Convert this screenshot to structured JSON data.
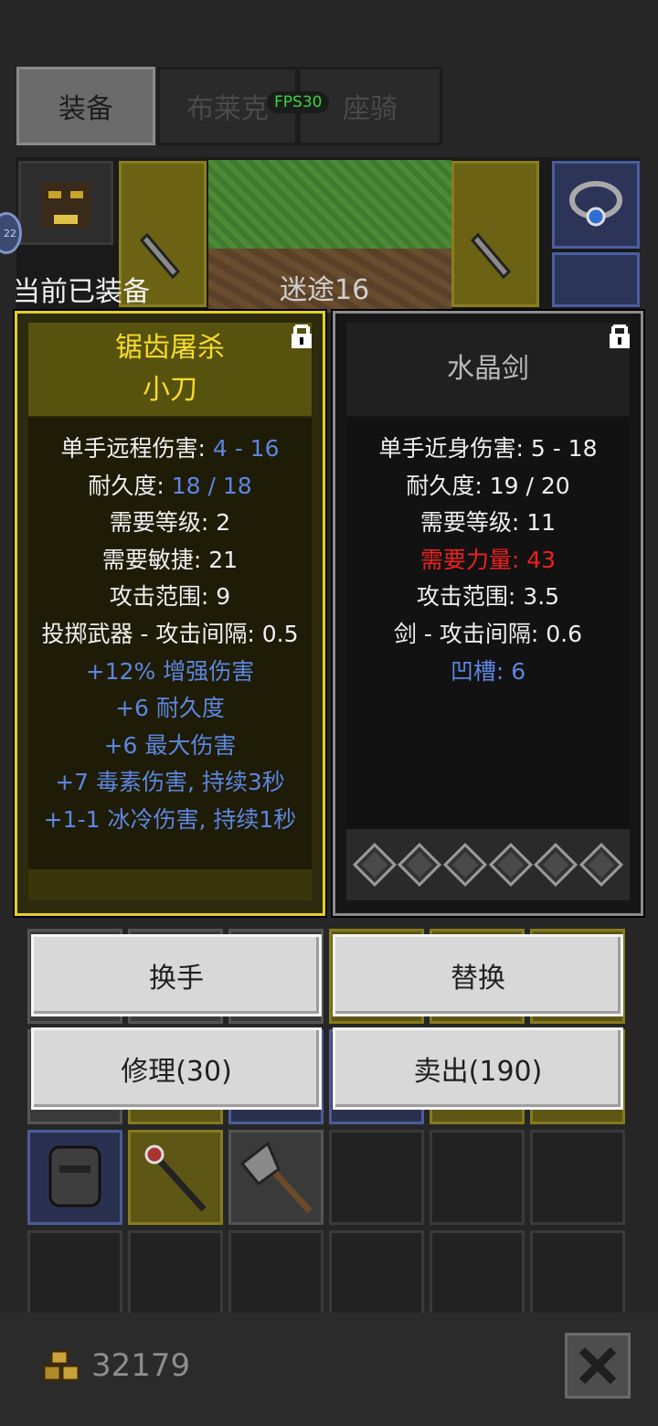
{
  "tabs": {
    "equip": "装备",
    "blake": "布莱克",
    "mount": "座骑"
  },
  "fps": "FPS30",
  "scene": {
    "map_label": "迷途16",
    "badge": "22"
  },
  "current_equipped_label": "当前已装备",
  "left_item": {
    "name_line1": "锯齿屠杀",
    "name_line2": "小刀",
    "stats": [
      {
        "label": "单手远程伤害: ",
        "value": "4 - 16"
      },
      {
        "label": "耐久度: ",
        "value": "18 / 18"
      },
      {
        "label": "需要等级: ",
        "value": "2"
      },
      {
        "label": "需要敏捷: ",
        "value": "21"
      },
      {
        "label": "攻击范围: ",
        "value": "9"
      },
      {
        "label": "投掷武器 - 攻击间隔: ",
        "value": "0.5"
      }
    ],
    "affixes": [
      "+12% 增强伤害",
      "+6 耐久度",
      "+6 最大伤害",
      "+7 毒素伤害, 持续3秒",
      "+1-1 冰冷伤害, 持续1秒"
    ]
  },
  "right_item": {
    "name": "水晶剑",
    "stats": [
      {
        "label": "单手近身伤害: ",
        "value": "5 - 18"
      },
      {
        "label": "耐久度: ",
        "value": "19 / 20"
      },
      {
        "label": "需要等级: ",
        "value": "11"
      },
      {
        "label": "需要力量: ",
        "value": "43"
      },
      {
        "label": "攻击范围: ",
        "value": "3.5"
      },
      {
        "label": "剑 - 攻击间隔: ",
        "value": "0.6"
      },
      {
        "label": "凹槽: ",
        "value": "6"
      }
    ],
    "socket_count": 6
  },
  "buttons": {
    "swap_hand": "换手",
    "replace": "替换",
    "repair": "修理(30)",
    "sell": "卖出(190)"
  },
  "gold": "32179",
  "colors": {
    "unique_yellow": "#f5db2a",
    "magic_blue": "#5d86e0",
    "requirement_red": "#f02020",
    "fps_green": "#3ad33a"
  },
  "icons": [
    "lock-icon",
    "gold-coins-icon",
    "close-icon",
    "dagger-icon",
    "amulet-icon",
    "helmet-icon",
    "staff-icon",
    "axe-icon"
  ]
}
